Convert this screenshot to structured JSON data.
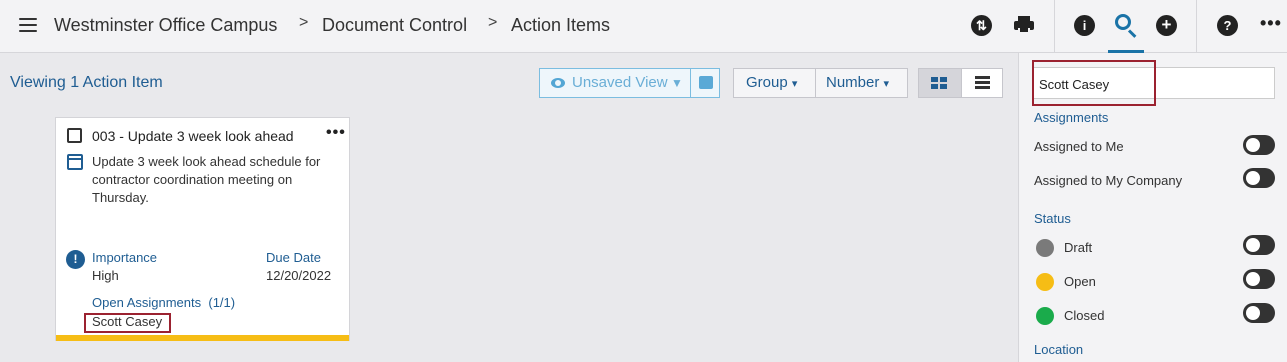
{
  "header": {
    "breadcrumb": [
      "Westminster Office Campus",
      "Document Control",
      "Action Items"
    ],
    "separator": ">",
    "icons": [
      "menu-icon",
      "sync-icon",
      "print-icon",
      "info-icon",
      "search-icon",
      "add-icon",
      "help-icon",
      "more-icon"
    ],
    "active_icon": "search-icon",
    "accent_color": "#1a73a7"
  },
  "main": {
    "viewing_label": "Viewing 1 Action Item",
    "toolbar": {
      "view_label": "Unsaved View",
      "group_label": "Group",
      "number_label": "Number",
      "active_layout": "grid"
    }
  },
  "card": {
    "title": "003 - Update 3 week look ahead",
    "description": "Update 3 week look ahead schedule for contractor coordination meeting on Thursday.",
    "importance_label": "Importance",
    "importance_value": "High",
    "due_label": "Due Date",
    "due_value": "12/20/2022",
    "assignments_label": "Open Assignments",
    "assignments_count": "(1/1)",
    "assignee": "Scott Casey",
    "status_color": "#f6bd15"
  },
  "panel": {
    "search_value": "Scott Casey",
    "assignments_heading": "Assignments",
    "assigned_to_me": "Assigned to Me",
    "assigned_to_company": "Assigned to My Company",
    "status_heading": "Status",
    "statuses": [
      {
        "label": "Draft",
        "color": "#7a7a7a"
      },
      {
        "label": "Open",
        "color": "#f6bd15"
      },
      {
        "label": "Closed",
        "color": "#1aab4b"
      }
    ],
    "location_heading": "Location"
  }
}
